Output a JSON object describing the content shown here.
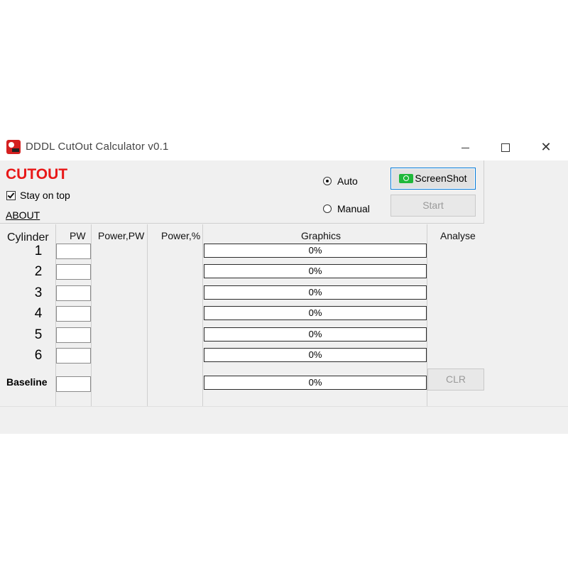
{
  "window": {
    "title": "DDDL CutOut Calculator v0.1",
    "icon": "app-logo-icon",
    "controls": {
      "minimize": "minimize-icon",
      "maximize": "maximize-icon",
      "close": "close-icon"
    },
    "close_glyph": "✕"
  },
  "top": {
    "heading": "CUTOUT",
    "heading_color": "#e81818",
    "stay_on_top": {
      "label": "Stay on top",
      "checked": true
    },
    "about_link": "ABOUT",
    "mode": {
      "auto_label": "Auto",
      "manual_label": "Manual",
      "selected": "Auto"
    },
    "screenshot_button": "ScreenShot",
    "start_button": "Start"
  },
  "table": {
    "headers": {
      "cylinder": "Cylinder",
      "pw": "PW",
      "power_pw": "Power,PW",
      "power_pct": "Power,%",
      "graphics": "Graphics",
      "analyse": "Analyse"
    },
    "rows": [
      {
        "label": "1",
        "pw": "",
        "power_pw": "",
        "power_pct": "",
        "graphic": "0%",
        "progress": 0
      },
      {
        "label": "2",
        "pw": "",
        "power_pw": "",
        "power_pct": "",
        "graphic": "0%",
        "progress": 0
      },
      {
        "label": "3",
        "pw": "",
        "power_pw": "",
        "power_pct": "",
        "graphic": "0%",
        "progress": 0
      },
      {
        "label": "4",
        "pw": "",
        "power_pw": "",
        "power_pct": "",
        "graphic": "0%",
        "progress": 0
      },
      {
        "label": "5",
        "pw": "",
        "power_pw": "",
        "power_pct": "",
        "graphic": "0%",
        "progress": 0
      },
      {
        "label": "6",
        "pw": "",
        "power_pw": "",
        "power_pct": "",
        "graphic": "0%",
        "progress": 0
      }
    ],
    "baseline": {
      "label": "Baseline",
      "pw": "",
      "graphic": "0%",
      "progress": 0
    },
    "clr_button": "CLR"
  },
  "colors": {
    "progress_fill": "#06b025",
    "accent_focus": "#0078d7"
  }
}
